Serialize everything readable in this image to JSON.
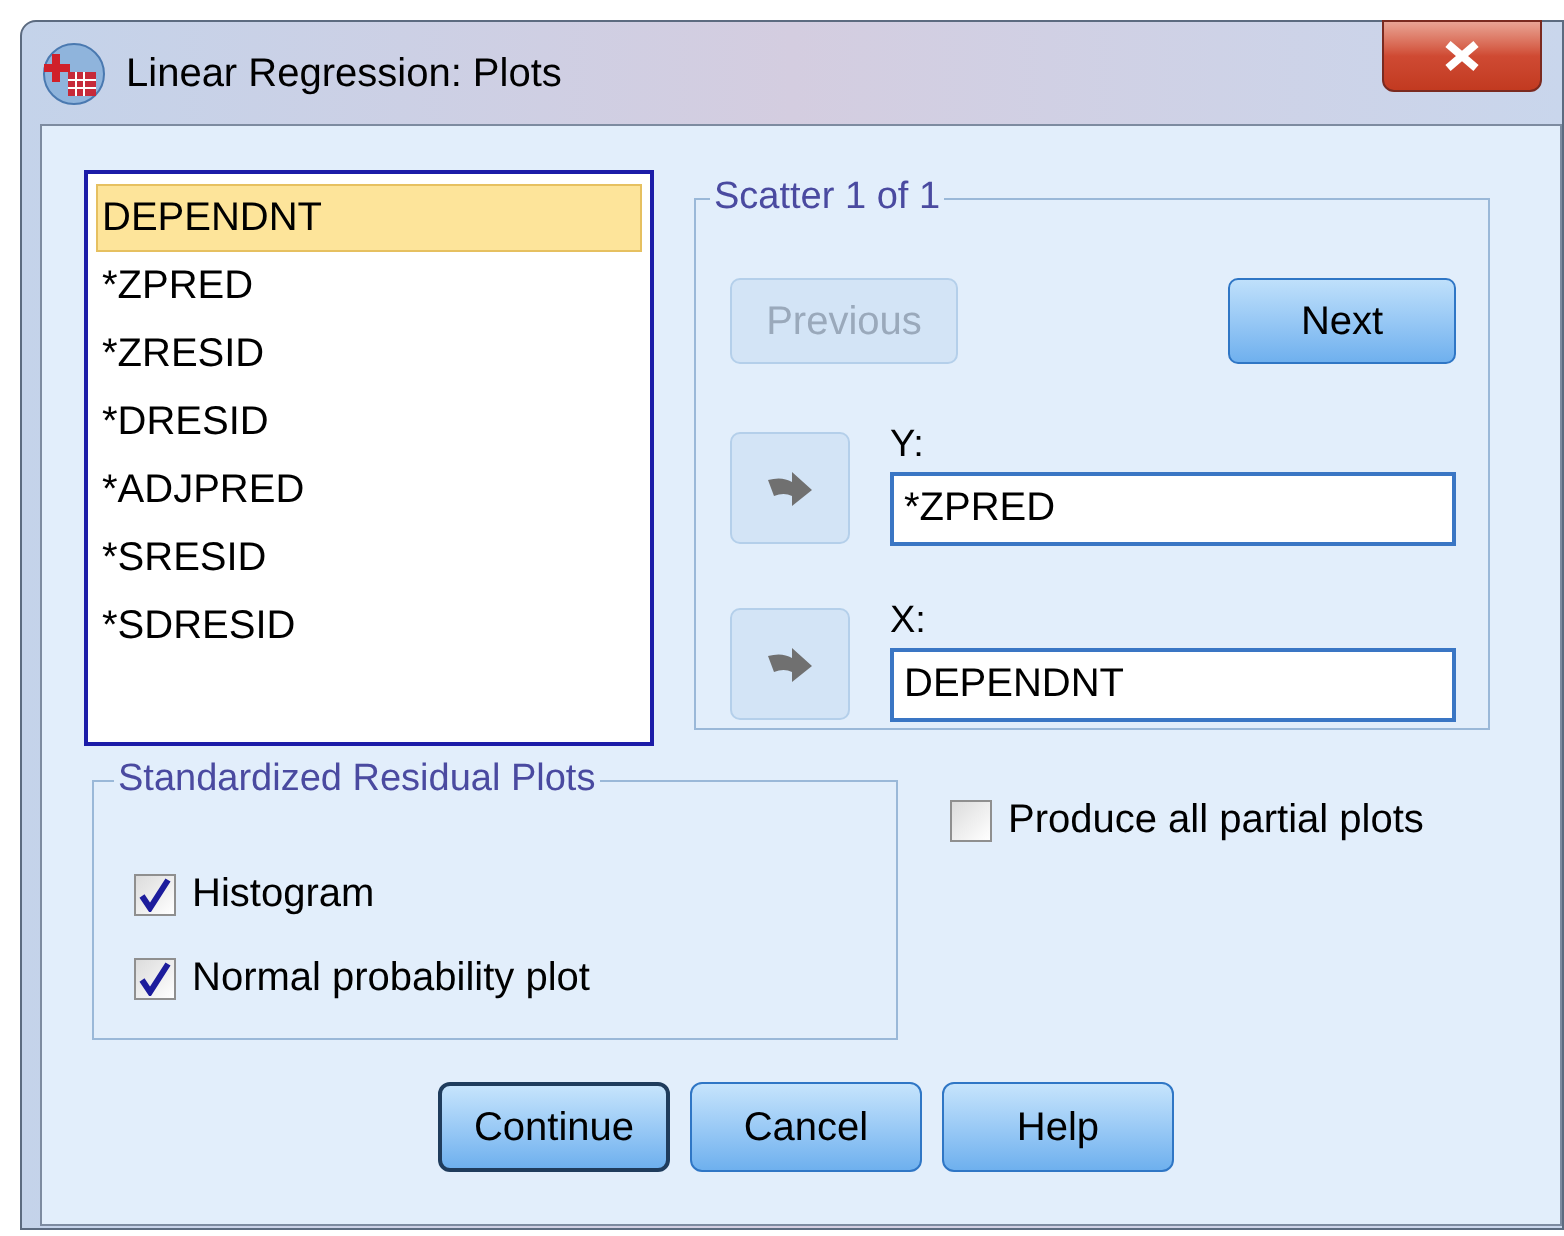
{
  "window": {
    "title": "Linear Regression: Plots"
  },
  "variables": [
    {
      "label": "DEPENDNT",
      "selected": true
    },
    {
      "label": "*ZPRED",
      "selected": false
    },
    {
      "label": "*ZRESID",
      "selected": false
    },
    {
      "label": "*DRESID",
      "selected": false
    },
    {
      "label": "*ADJPRED",
      "selected": false
    },
    {
      "label": "*SRESID",
      "selected": false
    },
    {
      "label": "*SDRESID",
      "selected": false
    }
  ],
  "scatter": {
    "title": "Scatter 1 of 1",
    "previous": {
      "label": "Previous",
      "disabled": true
    },
    "next": {
      "label": "Next",
      "disabled": false
    },
    "y": {
      "label": "Y:",
      "value": "*ZPRED"
    },
    "x": {
      "label": "X:",
      "value": "DEPENDNT"
    }
  },
  "residual_plots": {
    "title": "Standardized Residual Plots",
    "options": [
      {
        "label": "Histogram",
        "checked": true
      },
      {
        "label": "Normal probability plot",
        "checked": true
      }
    ]
  },
  "partial_plots": {
    "label": "Produce all partial plots",
    "checked": false
  },
  "buttons": [
    {
      "label": "Continue",
      "default": true
    },
    {
      "label": "Cancel",
      "default": false
    },
    {
      "label": "Help",
      "default": false
    }
  ]
}
